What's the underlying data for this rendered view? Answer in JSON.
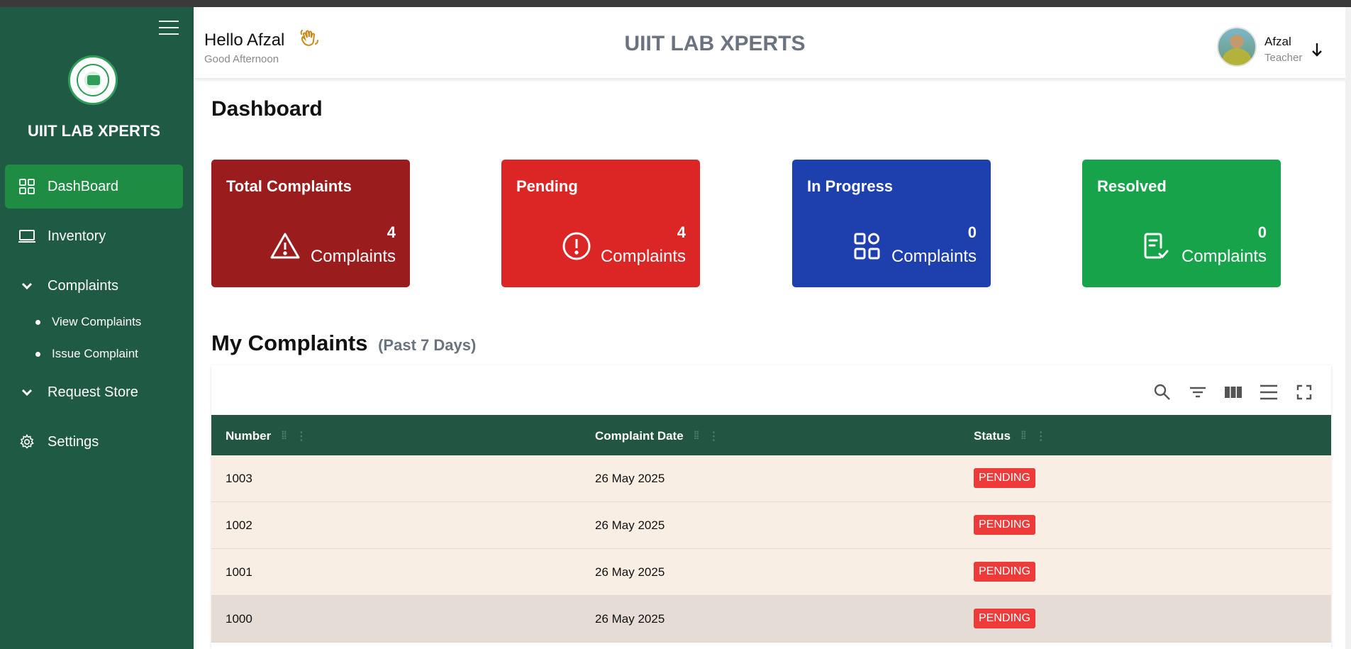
{
  "sidebar": {
    "brand": "UIIT LAB XPERTS",
    "items": [
      {
        "label": "DashBoard",
        "icon": "grid-icon"
      },
      {
        "label": "Inventory",
        "icon": "laptop-icon"
      },
      {
        "label": "Complaints",
        "icon": "chevron-down-icon"
      },
      {
        "label": "Request Store",
        "icon": "chevron-down-icon"
      },
      {
        "label": "Settings",
        "icon": "gear-icon"
      }
    ],
    "subitems": [
      {
        "label": "View Complaints"
      },
      {
        "label": "Issue Complaint"
      }
    ]
  },
  "header": {
    "hello": "Hello Afzal",
    "greeting": "Good Afternoon",
    "app_title": "UIIT LAB XPERTS",
    "user_name": "Afzal",
    "user_role": "Teacher"
  },
  "page_title": "Dashboard",
  "cards": [
    {
      "title": "Total Complaints",
      "count": "4",
      "label": "Complaints",
      "color": "#9b1c1c",
      "icon": "warning-icon"
    },
    {
      "title": "Pending",
      "count": "4",
      "label": "Complaints",
      "color": "#dc2626",
      "icon": "alert-circle-icon"
    },
    {
      "title": "In Progress",
      "count": "0",
      "label": "Complaints",
      "color": "#1e40af",
      "icon": "grid-icon"
    },
    {
      "title": "Resolved",
      "count": "0",
      "label": "Complaints",
      "color": "#16a34a",
      "icon": "clipboard-check-icon"
    }
  ],
  "complaints_section": {
    "title": "My Complaints",
    "subtitle": "(Past 7 Days)"
  },
  "table": {
    "columns": [
      "Number",
      "Complaint Date",
      "Status"
    ],
    "rows": [
      {
        "number": "1003",
        "date": "26 May 2025",
        "status": "PENDING"
      },
      {
        "number": "1002",
        "date": "26 May 2025",
        "status": "PENDING"
      },
      {
        "number": "1001",
        "date": "26 May 2025",
        "status": "PENDING"
      },
      {
        "number": "1000",
        "date": "26 May 2025",
        "status": "PENDING"
      }
    ],
    "toolbar": [
      "search-icon",
      "filter-icon",
      "columns-icon",
      "density-icon",
      "fullscreen-icon"
    ]
  },
  "colors": {
    "sidebar_bg": "#1f5a45",
    "active_item": "#1e8d43",
    "table_header": "#225643",
    "row_bg": "#f8eee3",
    "row_hover": "#e5ddd5",
    "badge": "#ef3a3a"
  }
}
